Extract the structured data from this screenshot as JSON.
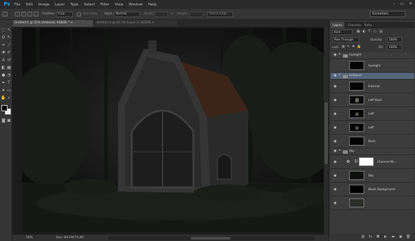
{
  "app": {
    "logo_text": "Ps"
  },
  "menu": [
    "File",
    "Edit",
    "Image",
    "Layer",
    "Type",
    "Select",
    "Filter",
    "View",
    "Window",
    "Help"
  ],
  "window_controls": [
    "–",
    "▭",
    "✕"
  ],
  "options_bar": {
    "feather_label": "Feather:",
    "feather_value": "0 px",
    "antialias_label": "Anti-alias",
    "style_label": "Style:",
    "style_value": "Normal",
    "width_label": "Width:",
    "height_label": "Height:",
    "refine_edge": "Refine Edge...",
    "workspace": "Essentials"
  },
  "tabs": [
    {
      "label": "Untitled-1 @ 50% (Ambient, RGB/8) * ×"
    },
    {
      "label": "Untitled-2 @ 66.7% (Layer 0, RGB/8) ×"
    }
  ],
  "status": {
    "zoom": "50%",
    "doc": "Doc: 69.1M/74.2M"
  },
  "panel": {
    "tabs": [
      "Layers",
      "Channels",
      "Paths"
    ],
    "filter_kind": "Kind",
    "blend_mode": "Pass Through",
    "opacity_label": "Opacity:",
    "opacity_value": "100%",
    "lock_label": "Lock:",
    "fill_label": "Fill:",
    "fill_value": "100%"
  },
  "layers": [
    {
      "name": "Sunlight",
      "kind": "group",
      "visible": true
    },
    {
      "name": "Sunlight",
      "kind": "layer",
      "visible": false
    },
    {
      "name": "Ambient",
      "kind": "group",
      "visible": true,
      "selected": true
    },
    {
      "name": "Internal",
      "kind": "layer",
      "visible": true
    },
    {
      "name": "Left Back",
      "kind": "layer",
      "visible": true
    },
    {
      "name": "Left",
      "kind": "layer",
      "visible": true
    },
    {
      "name": "Left",
      "kind": "layer",
      "visible": true
    },
    {
      "name": "Back",
      "kind": "layer",
      "visible": true
    },
    {
      "name": "Sky",
      "kind": "group",
      "visible": true
    },
    {
      "name": "Channel Mi...",
      "kind": "adjustment",
      "visible": true
    },
    {
      "name": "Sky",
      "kind": "layer",
      "visible": true
    },
    {
      "name": "Black Background",
      "kind": "layer",
      "visible": true
    },
    {
      "name": "",
      "kind": "layer",
      "visible": true
    }
  ],
  "colors": {
    "ps_blue": "#2fa3e6",
    "selection": "#55657a",
    "foreground": "#000000",
    "background": "#ffffff"
  }
}
